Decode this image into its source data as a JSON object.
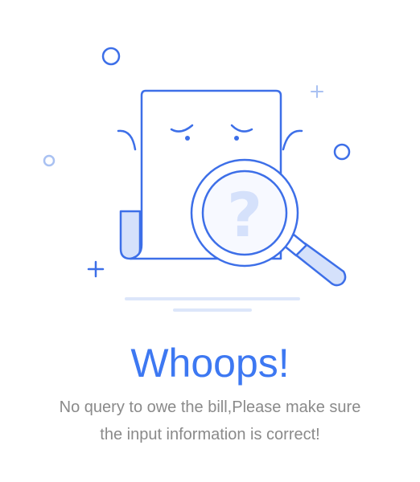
{
  "empty_state": {
    "title": "Whoops!",
    "message_line1": "No query to owe the bill,Please make sure",
    "message_line2": "the input information is correct!"
  },
  "illustration": {
    "subject": "document with magnifying glass",
    "glyph": "?",
    "colors": {
      "stroke": "#3d6fe8",
      "fill_light": "#d5e1fb",
      "shelf": "#dce6fa",
      "title": "#3d78f2",
      "message": "#8a8a8a"
    }
  }
}
